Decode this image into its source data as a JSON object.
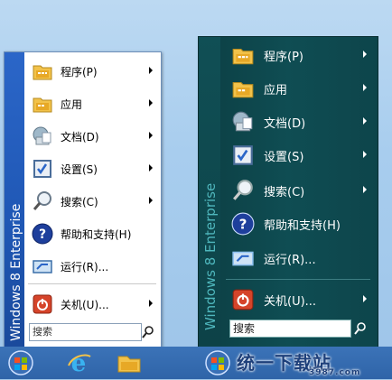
{
  "left_menu": {
    "banner_text": "Windows 8 Enterprise",
    "items": [
      {
        "label": "程序(P)",
        "icon": "programs-folder-icon",
        "has_submenu": true
      },
      {
        "label": "应用",
        "icon": "apps-folder-icon",
        "has_submenu": true
      },
      {
        "label": "文档(D)",
        "icon": "documents-icon",
        "has_submenu": true
      },
      {
        "label": "设置(S)",
        "icon": "settings-icon",
        "has_submenu": true
      },
      {
        "label": "搜索(C)",
        "icon": "search-magnifier-icon",
        "has_submenu": true
      },
      {
        "label": "帮助和支持(H)",
        "icon": "help-icon",
        "has_submenu": false
      },
      {
        "label": "运行(R)...",
        "icon": "run-icon",
        "has_submenu": false
      },
      {
        "label": "关机(U)...",
        "icon": "shutdown-icon",
        "has_submenu": true
      }
    ],
    "search_placeholder": "搜索"
  },
  "right_menu": {
    "banner_text": "Windows 8 Enterprise",
    "items": [
      {
        "label": "程序(P)",
        "icon": "programs-folder-icon",
        "has_submenu": true
      },
      {
        "label": "应用",
        "icon": "apps-folder-icon",
        "has_submenu": true
      },
      {
        "label": "文档(D)",
        "icon": "documents-icon",
        "has_submenu": true
      },
      {
        "label": "设置(S)",
        "icon": "settings-icon",
        "has_submenu": true
      },
      {
        "label": "搜索(C)",
        "icon": "search-magnifier-icon",
        "has_submenu": true
      },
      {
        "label": "帮助和支持(H)",
        "icon": "help-icon",
        "has_submenu": false
      },
      {
        "label": "运行(R)...",
        "icon": "run-icon",
        "has_submenu": false
      },
      {
        "label": "关机(U)...",
        "icon": "shutdown-icon",
        "has_submenu": true
      }
    ],
    "search_value": "搜索"
  },
  "taskbar": {
    "buttons": [
      "start-orb-icon",
      "internet-explorer-icon",
      "file-explorer-icon",
      "start-orb-icon"
    ]
  },
  "watermark": {
    "text": "统一下载站",
    "subtext": "3987.com"
  },
  "colors": {
    "left_banner": "#1f57b4",
    "right_background": "#0f4d53",
    "right_banner_text": "#4fb7bd",
    "taskbar": "#2f64a8"
  }
}
